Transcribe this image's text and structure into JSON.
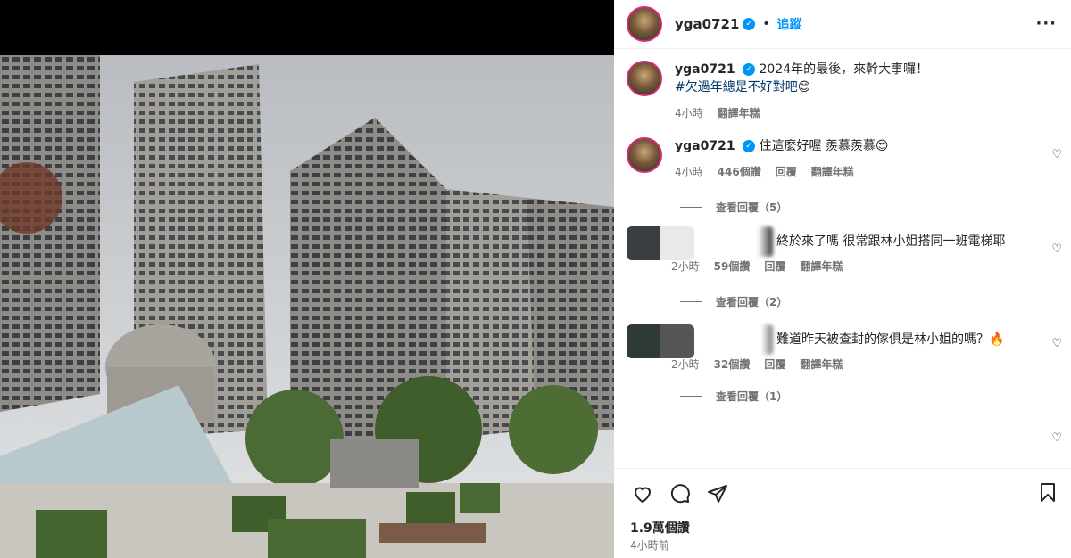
{
  "post": {
    "username": "yga0721",
    "follow_label": "追蹤",
    "caption_text": "2024年的最後，來幹大事囉！",
    "caption_hashtag": "#欠過年總是不好對吧",
    "caption_emoji": "😊",
    "caption_time": "4小時",
    "caption_translate": "翻譯年糕",
    "likes": "1.9萬個讚",
    "posted_ago": "4小時前"
  },
  "comments": [
    {
      "username": "yga0721",
      "text": "住這麼好喔 羨慕羨慕😍",
      "time": "4小時",
      "likes": "446個讚",
      "reply": "回覆",
      "translate": "翻譯年糕",
      "view_replies": "查看回覆（5）"
    },
    {
      "username": "",
      "text": "終於來了嗎 很常跟林小姐搭同一班電梯耶",
      "time": "2小時",
      "likes": "59個讚",
      "reply": "回覆",
      "translate": "翻譯年糕",
      "view_replies": "查看回覆（2）"
    },
    {
      "username": "",
      "text": "難道昨天被查封的傢俱是林小姐的嗎？🔥",
      "time": "2小時",
      "likes": "32個讚",
      "reply": "回覆",
      "translate": "翻譯年糕",
      "view_replies": "查看回覆（1）"
    }
  ],
  "icons": {
    "verified": "verified-badge-icon",
    "more": "more-options-icon",
    "heart": "heart-icon",
    "comment": "comment-icon",
    "share": "share-icon",
    "bookmark": "bookmark-icon"
  },
  "colors": {
    "accent": "#0095f6",
    "muted": "#737373"
  }
}
